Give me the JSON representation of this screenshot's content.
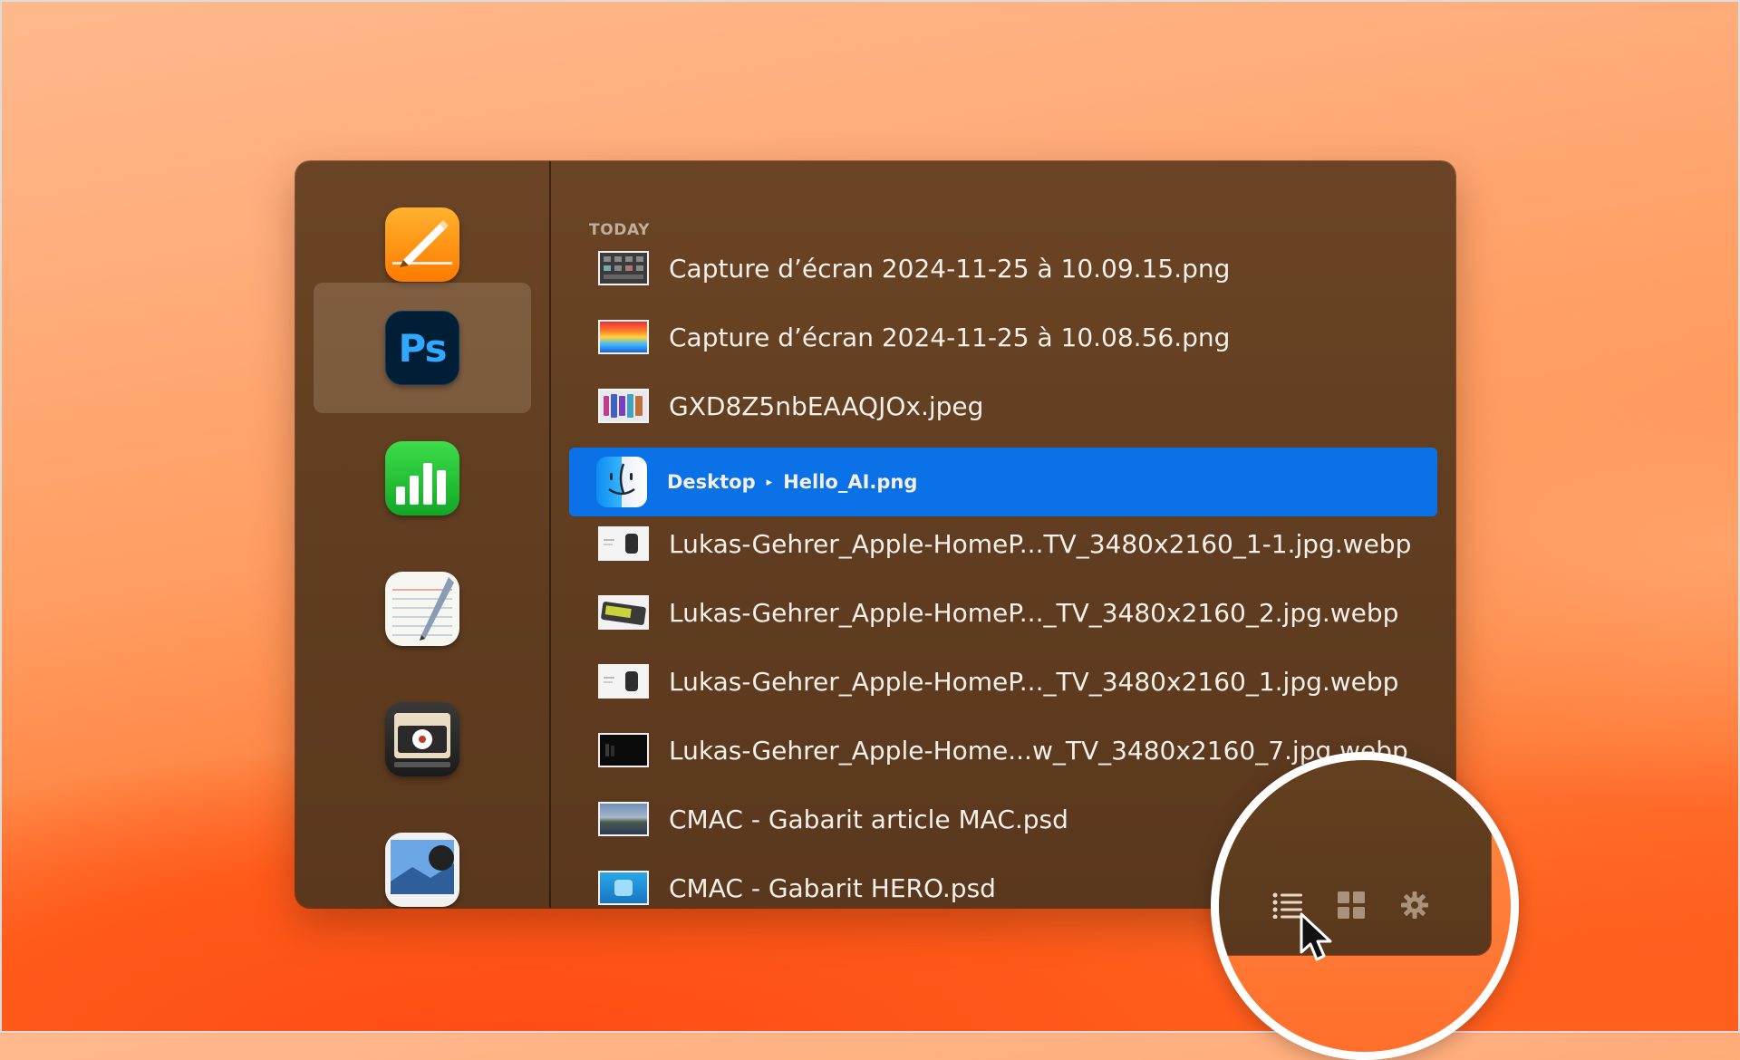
{
  "section": {
    "header": "TODAY"
  },
  "sidebar": {
    "apps": [
      {
        "name": "Pages",
        "icon": "pages-icon",
        "selected": false
      },
      {
        "name": "Adobe Photoshop",
        "icon": "photoshop-icon",
        "label": "Ps",
        "selected": true
      },
      {
        "name": "Numbers",
        "icon": "numbers-icon",
        "selected": false
      },
      {
        "name": "TextEdit",
        "icon": "textedit-icon",
        "selected": false
      },
      {
        "name": "DVD Player",
        "icon": "dvd-player-icon",
        "selected": false
      },
      {
        "name": "Preview",
        "icon": "preview-icon",
        "selected": false
      }
    ]
  },
  "files": [
    {
      "name": "Capture d’écran 2024-11-25 à 10.09.15.png",
      "thumb": "screenshot-thumb"
    },
    {
      "name": "Capture d’écran 2024-11-25 à 10.08.56.png",
      "thumb": "rainbow-thumb"
    },
    {
      "name": "GXD8Z5nbEAAQJOx.jpeg",
      "thumb": "phones-thumb"
    },
    {
      "folder": "Desktop",
      "name": "Hello_AI.png",
      "thumb": "finder-icon",
      "selected": true
    },
    {
      "name": "Lukas-Gehrer_Apple-HomeP...TV_3480x2160_1-1.jpg.webp",
      "thumb": "homepod-thumb"
    },
    {
      "name": "Lukas-Gehrer_Apple-HomeP..._TV_3480x2160_2.jpg.webp",
      "thumb": "homepod-green-thumb"
    },
    {
      "name": "Lukas-Gehrer_Apple-HomeP..._TV_3480x2160_1.jpg.webp",
      "thumb": "homepod-thumb"
    },
    {
      "name": "Lukas-Gehrer_Apple-Home...w_TV_3480x2160_7.jpg.webp",
      "thumb": "dark-thumb"
    },
    {
      "name": "CMAC - Gabarit article MAC.psd",
      "thumb": "landscape-thumb"
    },
    {
      "name": "CMAC - Gabarit HERO.psd",
      "thumb": "hero-thumb"
    }
  ],
  "toolbar": {
    "buttons": [
      {
        "icon": "list-view-icon",
        "active": true
      },
      {
        "icon": "grid-view-icon",
        "active": false
      },
      {
        "icon": "gear-icon",
        "active": false
      }
    ]
  },
  "colors": {
    "selection": "#0a72e6",
    "window_bg": "#5f3c20",
    "text": "#f4efe9",
    "section_header": "#bfae9a"
  }
}
